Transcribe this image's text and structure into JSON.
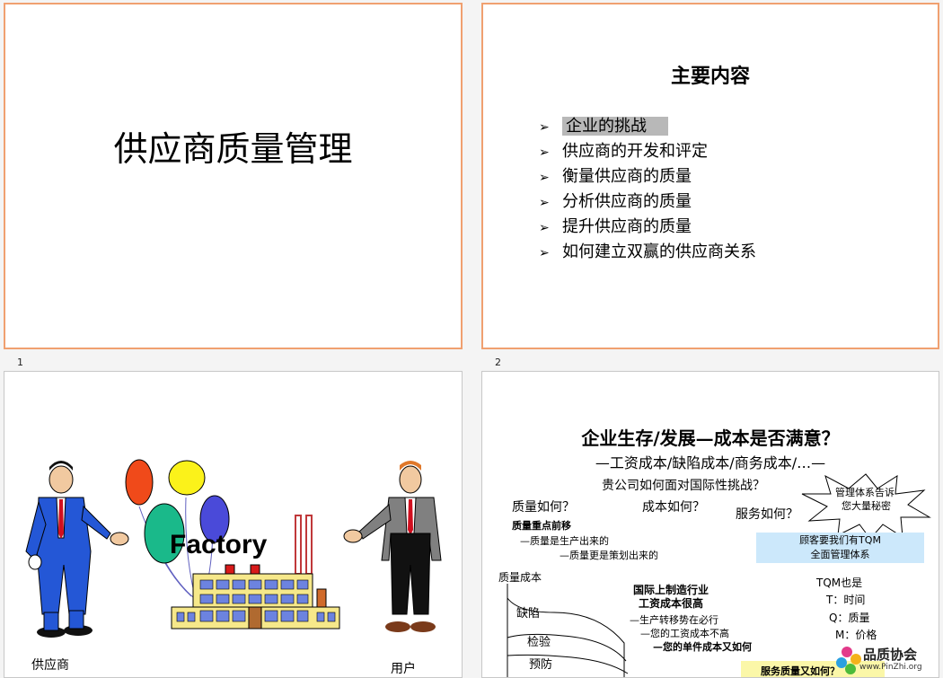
{
  "slides": [
    {
      "number": "1",
      "title": "供应商质量管理"
    },
    {
      "number": "2",
      "title": "主要内容",
      "items": [
        "企业的挑战",
        "供应商的开发和评定",
        "衡量供应商的质量",
        "分析供应商的质量",
        "提升供应商的质量",
        "如何建立双赢的供应商关系"
      ]
    },
    {
      "factory_label": "Factory",
      "supplier_label": "供应商",
      "user_label": "用户"
    },
    {
      "headline": "企业生存/发展—成本是否满意？",
      "subhead": "—工资成本/缺陷成本/商务成本/…—",
      "challenge": "贵公司如何面对国际性挑战？",
      "burst_line1": "管理体系告诉",
      "burst_line2": "您大量秘密",
      "quality_q": "质量如何？",
      "cost_q": "成本如何？",
      "service_q": "服务如何？",
      "focus_title": "质量重点前移",
      "focus_1": "—质量是生产出来的",
      "focus_2": "—质量更是策划出来的",
      "tqm_box_1": "顾客要我们有TQM",
      "tqm_box_2": "全面管理体系",
      "curve_ylabel": "质量成本",
      "curve_1": "缺陷",
      "curve_2": "检验",
      "curve_3": "预防",
      "intl_1": "国际上制造行业",
      "intl_2": "工资成本很高",
      "intl_3": "—生产转移势在必行",
      "intl_4": "—您的工资成本不高",
      "intl_5": "—您的单件成本又如何",
      "tqm_also": "TQM也是",
      "t_line": "T：时间",
      "q_line": "Q：质量",
      "m_line": "M：价格",
      "bottom_banner": "服务质量又如何？",
      "logo_cn": "品质协会",
      "logo_url": "www.PinZhi.org"
    }
  ]
}
